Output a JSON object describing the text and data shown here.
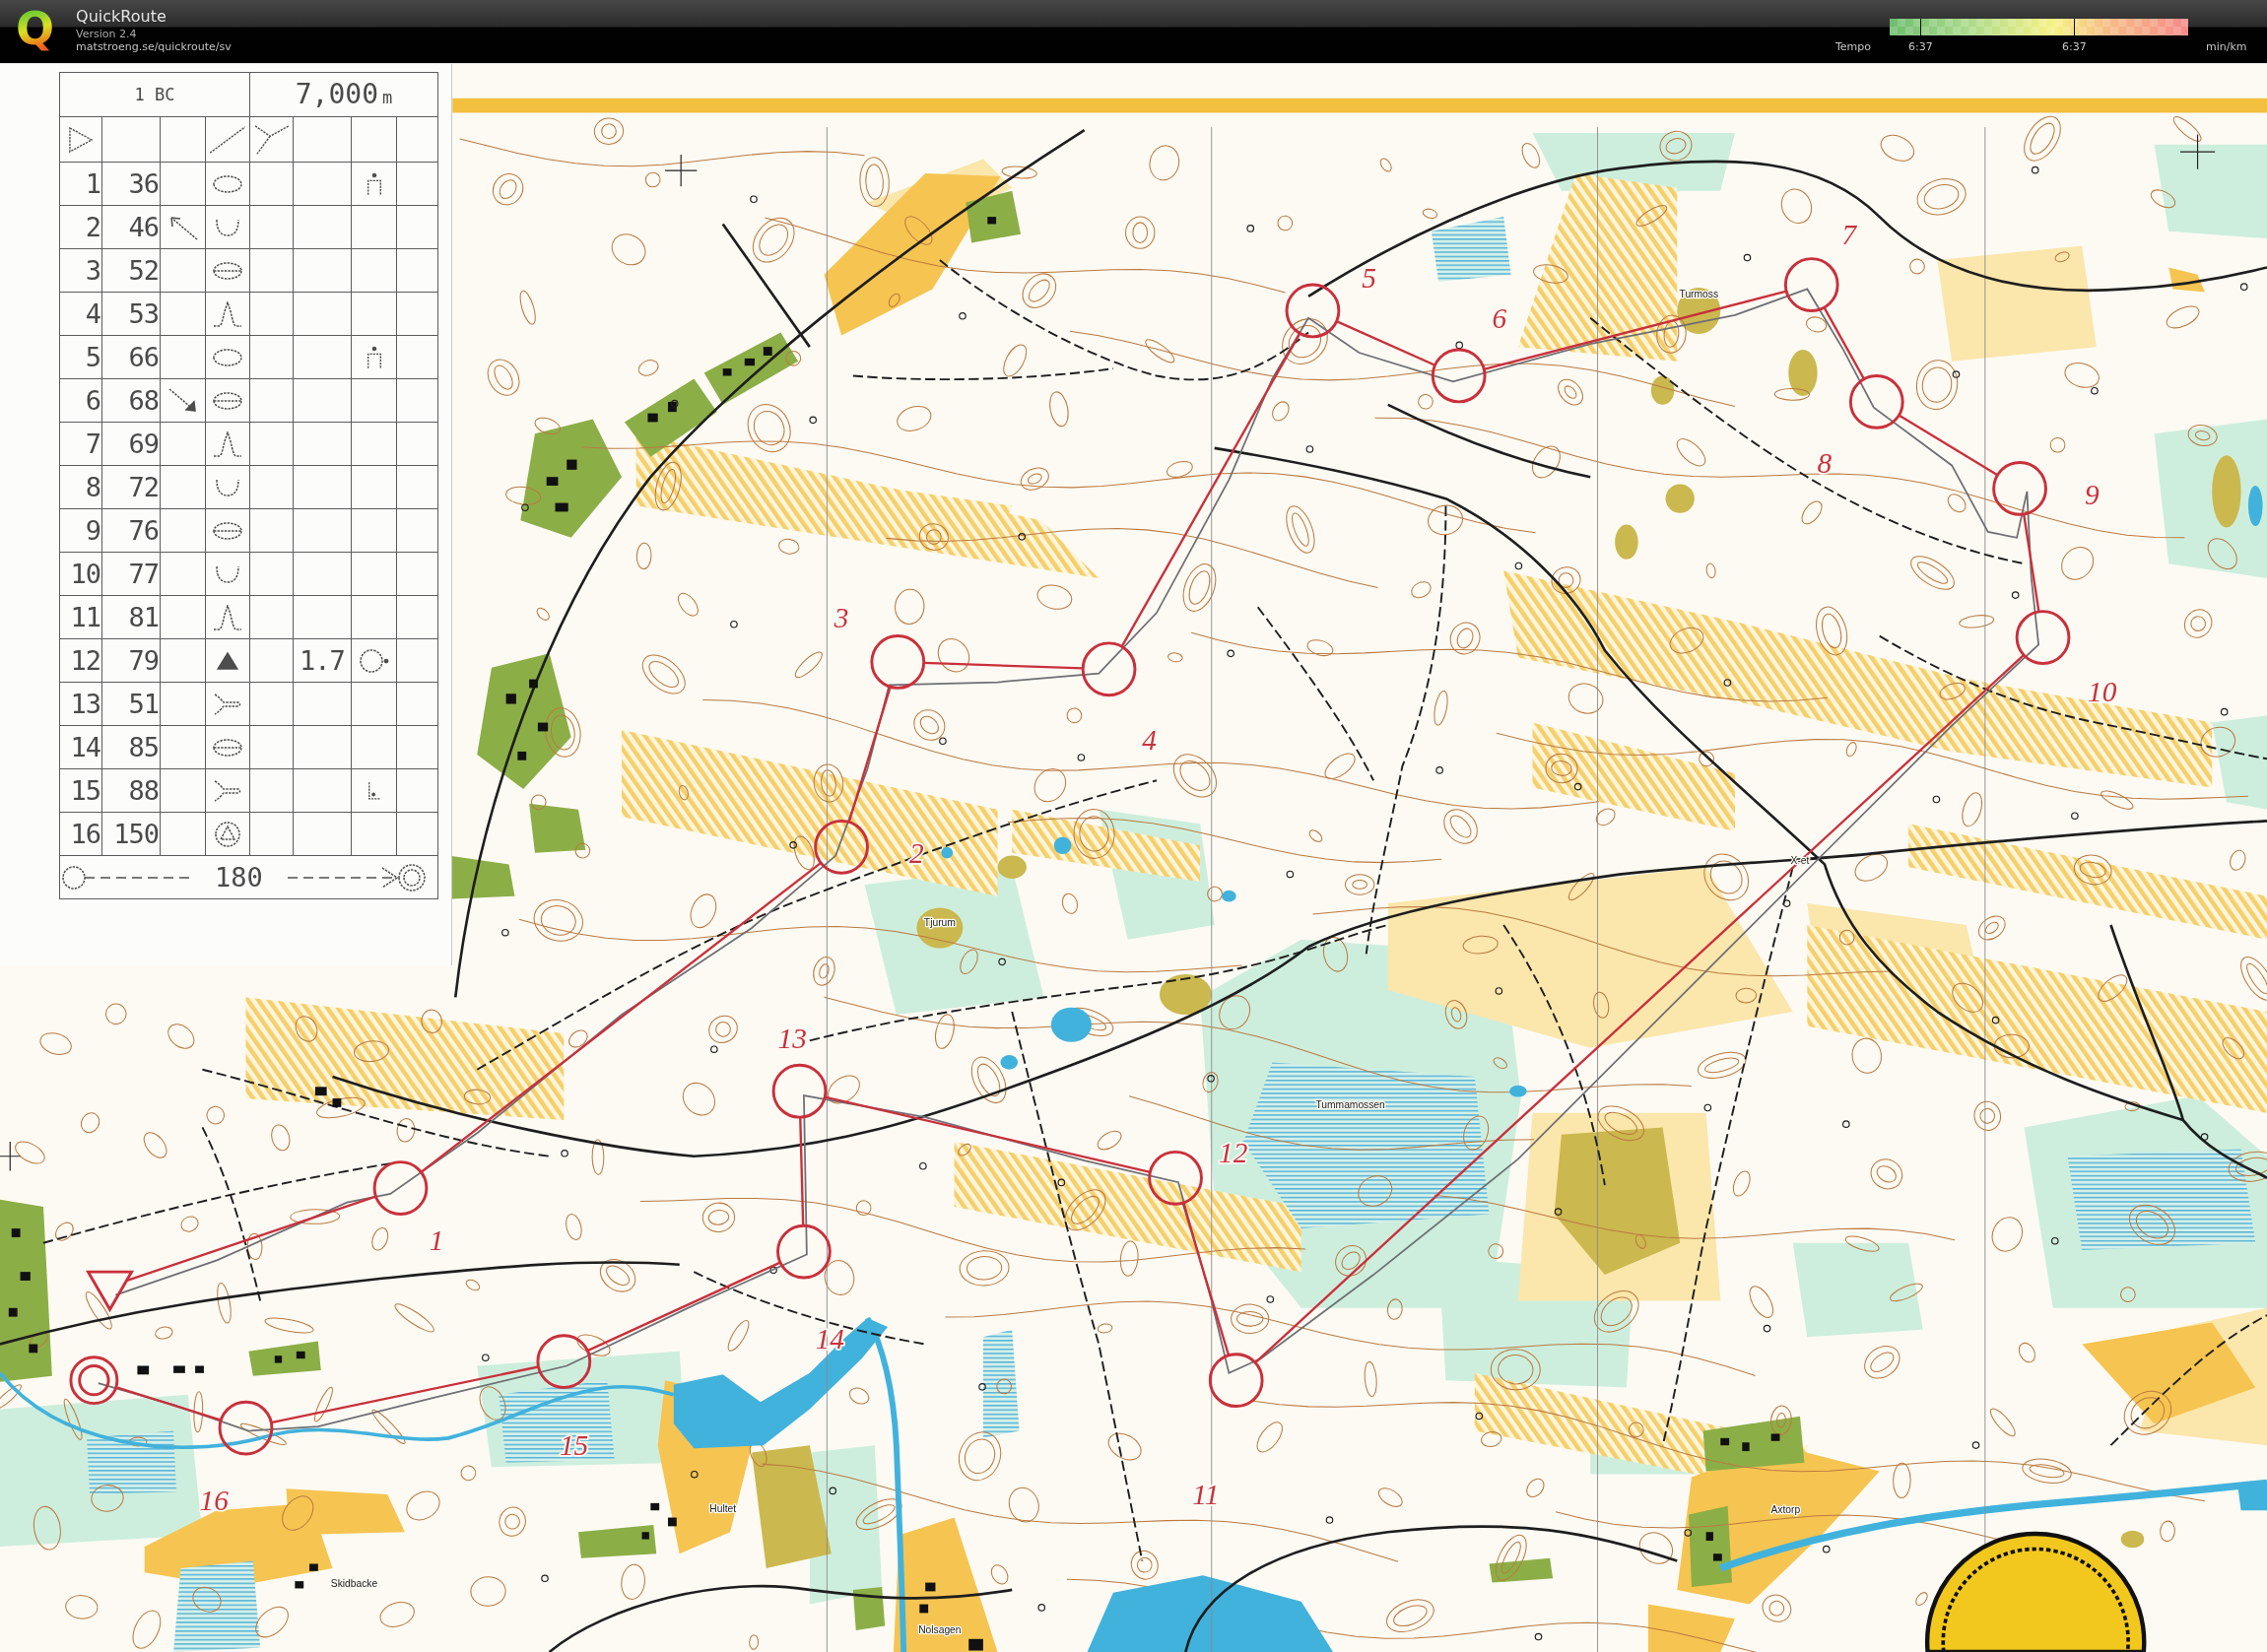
{
  "header": {
    "logo_letter": "Q",
    "app_name": "QuickRoute",
    "version": "Version 2.4",
    "url": "matstroeng.se/quickroute/sv"
  },
  "tempo_legend": {
    "label": "Tempo",
    "ticks": [
      "6:37",
      "6:37"
    ],
    "unit": "min/km"
  },
  "control_card": {
    "course": "1 BC",
    "length": "7,000",
    "length_unit": "m",
    "controls": [
      {
        "number": "1",
        "code": "36"
      },
      {
        "number": "2",
        "code": "46"
      },
      {
        "number": "3",
        "code": "52"
      },
      {
        "number": "4",
        "code": "53"
      },
      {
        "number": "5",
        "code": "66"
      },
      {
        "number": "6",
        "code": "68"
      },
      {
        "number": "7",
        "code": "69"
      },
      {
        "number": "8",
        "code": "72"
      },
      {
        "number": "9",
        "code": "76"
      },
      {
        "number": "10",
        "code": "77"
      },
      {
        "number": "11",
        "code": "81"
      },
      {
        "number": "12",
        "code": "79",
        "dimension": "1.7"
      },
      {
        "number": "13",
        "code": "51"
      },
      {
        "number": "14",
        "code": "85"
      },
      {
        "number": "15",
        "code": "88"
      },
      {
        "number": "16",
        "code": "150"
      }
    ],
    "finish_distance": "180"
  },
  "map": {
    "place_names": [
      "Turmoss",
      "Tjurum",
      "X-et",
      "Tummamossen",
      "Hultet",
      "Skidbacke",
      "Axtorp",
      "Nolsagen"
    ],
    "control_labels": [
      "1",
      "2",
      "3",
      "4",
      "5",
      "6",
      "7",
      "8",
      "9",
      "10",
      "11",
      "12",
      "13",
      "14",
      "15",
      "16"
    ]
  }
}
